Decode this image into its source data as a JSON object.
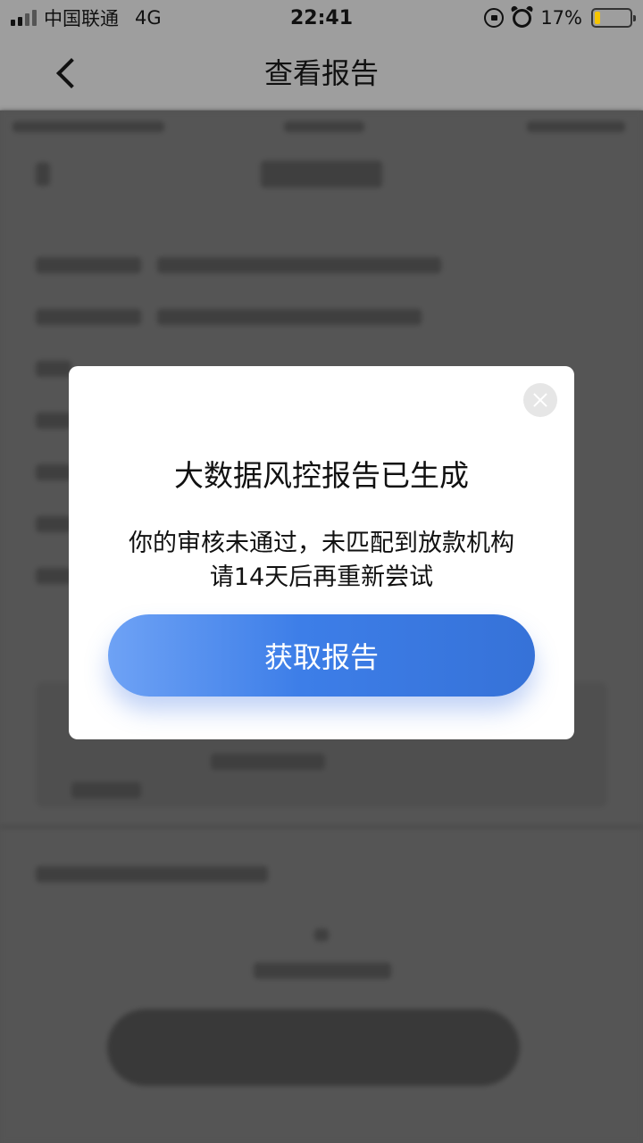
{
  "status_bar": {
    "carrier": "中国联通",
    "network": "4G",
    "time": "22:41",
    "battery": "17%",
    "battery_level": 0.17
  },
  "nav": {
    "title": "查看报告"
  },
  "modal": {
    "title": "大数据风控报告已生成",
    "message_line1": "你的审核未通过，未匹配到放款机构",
    "message_line2": "请14天后再重新尝试",
    "button_label": "获取报告"
  },
  "colors": {
    "accent_start": "#6ea2f5",
    "accent_end": "#3672d8",
    "battery_fill": "#f5c400"
  }
}
